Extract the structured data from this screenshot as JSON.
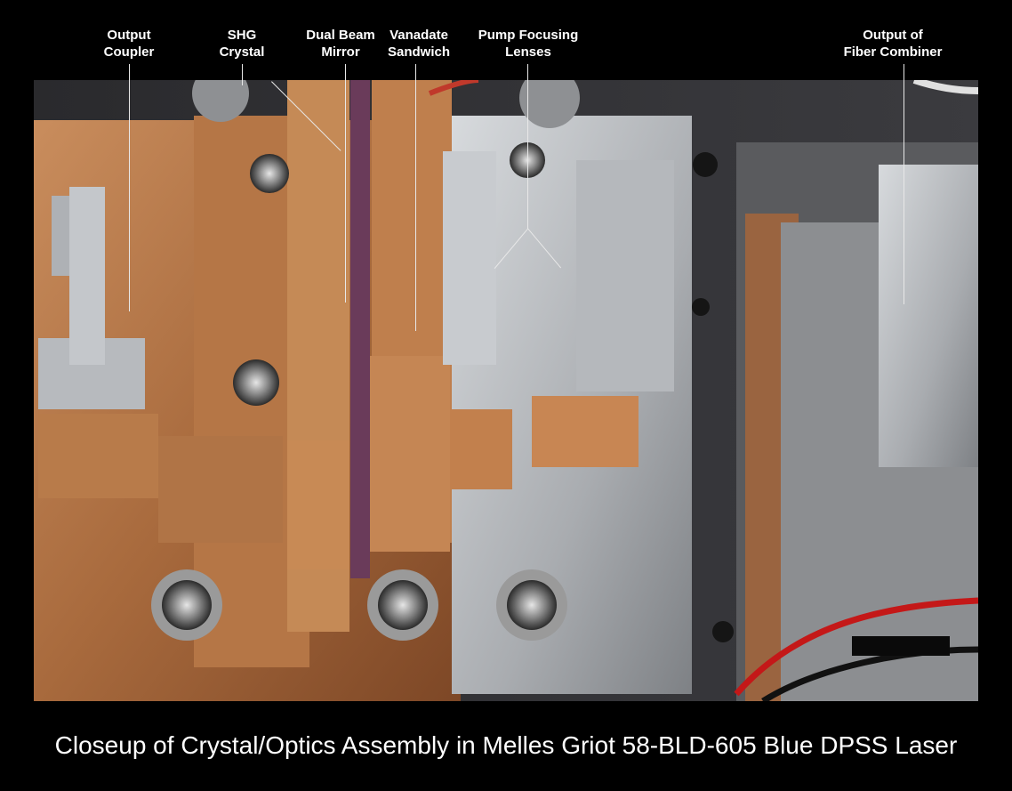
{
  "labels": {
    "output_coupler": "Output\nCoupler",
    "shg_crystal": "SHG\nCrystal",
    "dual_beam_mirror": "Dual Beam\nMirror",
    "vanadate_sandwich": "Vanadate\nSandwich",
    "pump_focusing_lenses": "Pump Focusing\nLenses",
    "fiber_combiner_output": "Output of\nFiber Combiner"
  },
  "caption": "Closeup of Crystal/Optics Assembly in Melles Griot 58-BLD-605 Blue DPSS Laser",
  "colors": {
    "background": "#000000",
    "copper": "#b97a4c",
    "copper_dark": "#7a4526",
    "aluminum": "#b9bcc0",
    "steel": "#8d9094",
    "text": "#ffffff"
  }
}
